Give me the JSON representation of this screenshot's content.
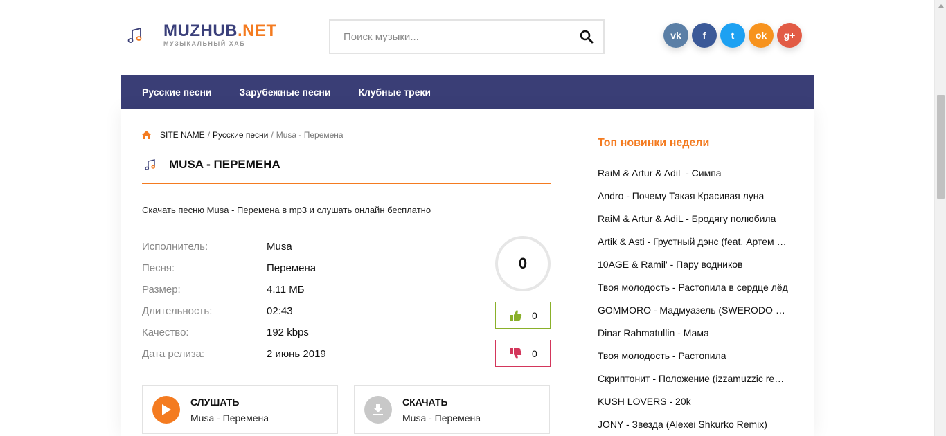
{
  "header": {
    "logo_title": "MUZHUB",
    "logo_tld": ".NET",
    "logo_subtitle": "МУЗЫКАЛЬНЫЙ ХАБ",
    "search_placeholder": "Поиск музыки..."
  },
  "socials": [
    {
      "name": "vk",
      "label": "vk",
      "color": "#5b7fa6"
    },
    {
      "name": "facebook",
      "label": "f",
      "color": "#3b5998"
    },
    {
      "name": "twitter",
      "label": "t",
      "color": "#1da1f2"
    },
    {
      "name": "odnoklassniki",
      "label": "ok",
      "color": "#f7931e"
    },
    {
      "name": "google-plus",
      "label": "g+",
      "color": "#e25b45"
    }
  ],
  "nav": {
    "items": [
      "Русские песни",
      "Зарубежные песни",
      "Клубные треки"
    ]
  },
  "breadcrumb": {
    "site": "SITE NAME",
    "sep": "/",
    "category": "Русские песни",
    "current": "Musa - Перемена"
  },
  "song": {
    "title": "MUSA - ПЕРЕМЕНА",
    "description": "Скачать песню Musa - Перемена в mp3 и слушать онлайн бесплатно",
    "info": [
      {
        "k": "Исполнитель:",
        "v": "Musa"
      },
      {
        "k": "Песня:",
        "v": "Перемена"
      },
      {
        "k": "Размер:",
        "v": "4.11 МБ"
      },
      {
        "k": "Длительность:",
        "v": "02:43"
      },
      {
        "k": "Качество:",
        "v": "192 kbps"
      },
      {
        "k": "Дата релиза:",
        "v": "2 июнь 2019"
      }
    ],
    "rating": "0",
    "likes": "0",
    "dislikes": "0"
  },
  "actions": {
    "listen_label": "СЛУШАТЬ",
    "listen_sub": "Musa - Перемена",
    "download_label": "СКАЧАТЬ",
    "download_sub": "Musa - Перемена"
  },
  "sidebar": {
    "title": "Топ новинки недели",
    "items": [
      "RaiM & Artur & AdiL - Симпа",
      "Andro - Почему Такая Красивая луна",
      "RaiM & Artur & AdiL - Бродягу полюбила",
      "Artik & Asti - Грустный дэнс (feat. Артем Качер)",
      "10AGE & Ramil' - Пару водников",
      "Твоя молодость - Растопила в сердце лёд",
      "GOMMORO - Мадмуазель (SWERODO Remix)",
      "Dinar Rahmatullin - Мама",
      "Твоя молодость - Растопила",
      "Скриптонит - Положение (izzamuzzic remix)",
      "KUSH LOVERS - 20k",
      "JONY - Звезда (Alexei Shkurko Remix)"
    ]
  },
  "colors": {
    "accent": "#f47b20",
    "nav_bg": "#3a3e76",
    "like": "#8ab02a",
    "dislike": "#d3365b"
  }
}
